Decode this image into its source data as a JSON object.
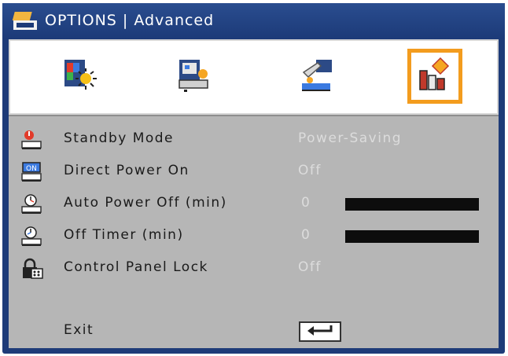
{
  "window": {
    "title": "OPTIONS | Advanced",
    "title_icon": "options-icon"
  },
  "tabs": [
    {
      "name": "image-settings-icon",
      "selected": false
    },
    {
      "name": "display-settings-icon",
      "selected": false
    },
    {
      "name": "setup-settings-icon",
      "selected": false
    },
    {
      "name": "options-settings-icon",
      "selected": true
    }
  ],
  "menu": {
    "items": [
      {
        "label": "Standby Mode",
        "value": "Power-Saving",
        "icon": "standby-icon"
      },
      {
        "label": "Direct Power On",
        "value": "Off",
        "icon": "direct-power-icon"
      },
      {
        "label": "Auto Power Off (min)",
        "value": "0",
        "icon": "auto-power-off-icon",
        "bar_fill": 1.0
      },
      {
        "label": "Off Timer (min)",
        "value": "0",
        "icon": "timer-icon",
        "bar_fill": 1.0
      },
      {
        "label": "Control Panel Lock",
        "value": "Off",
        "icon": "lock-icon"
      }
    ],
    "exit_label": "Exit",
    "exit_icon": "enter-key-icon"
  },
  "colors": {
    "frame": "#1e3b78",
    "panel": "#b6b6b6",
    "selected_tab_border": "#f39c1e",
    "value_text": "#dcdcdc",
    "slider_bar": "#0d0d0d"
  }
}
